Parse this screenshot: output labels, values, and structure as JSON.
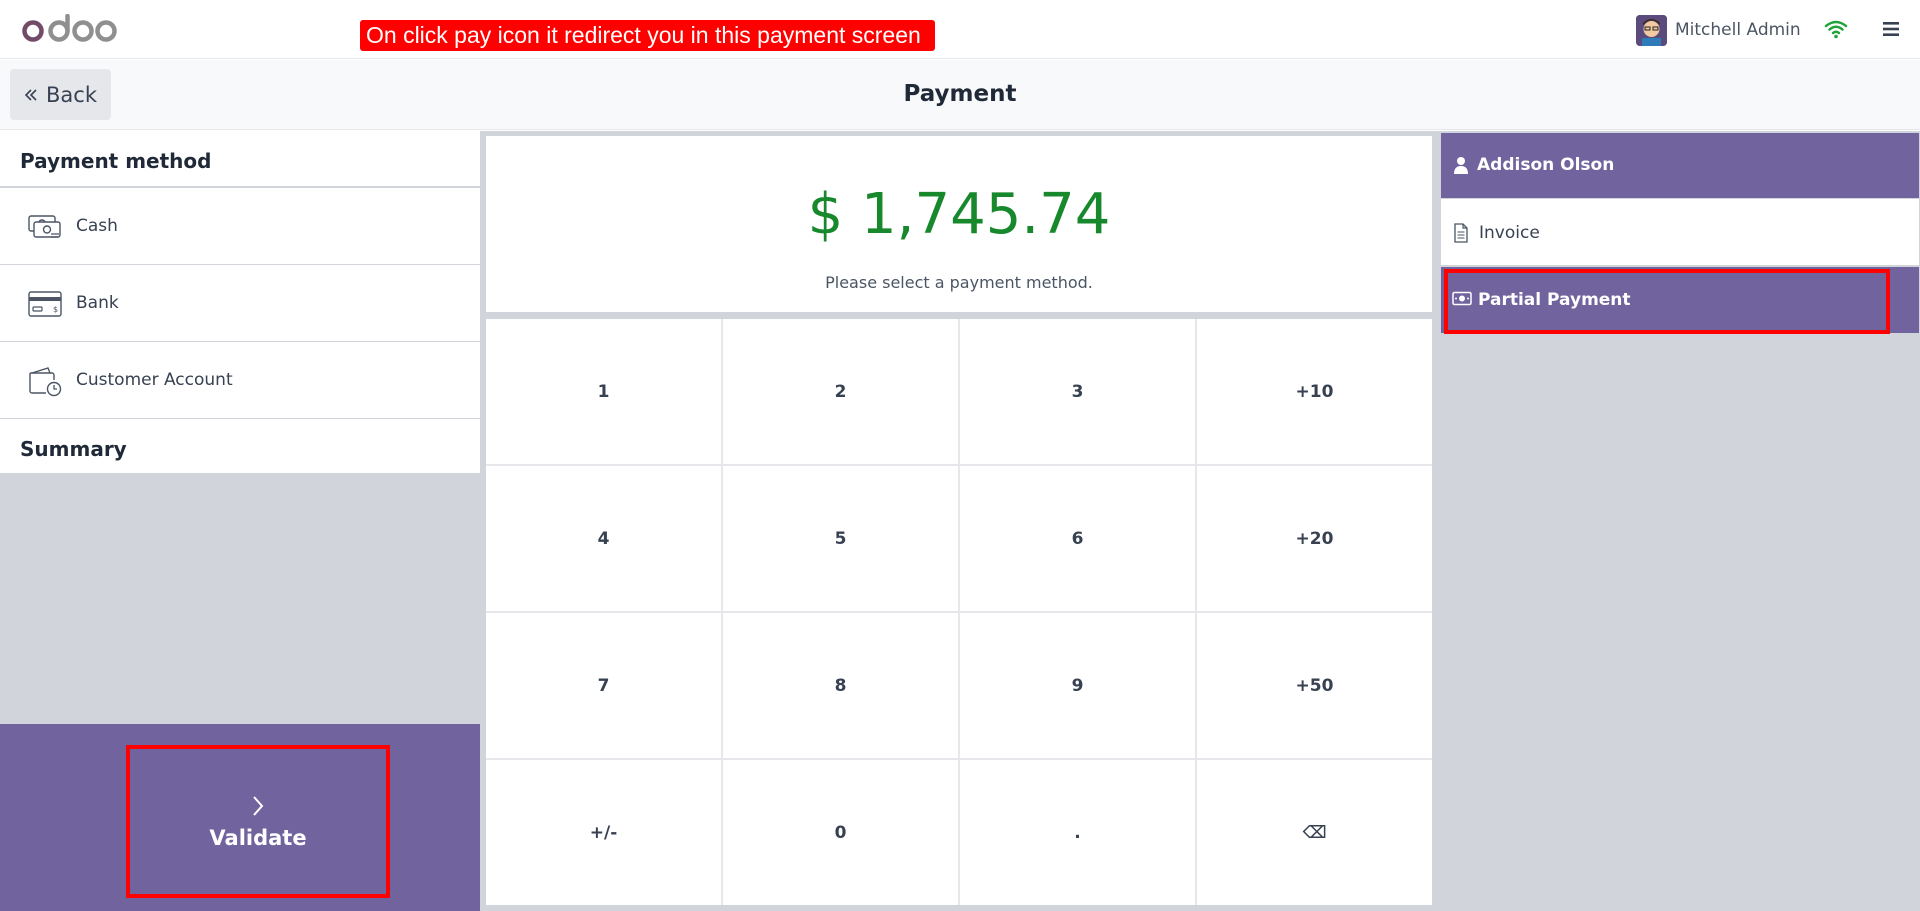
{
  "topbar": {
    "logo_text": "odoo",
    "annotation": "On click pay icon it redirect you in this payment screen",
    "user_name": "Mitchell Admin",
    "icons": [
      "avatar",
      "wifi-icon",
      "hamburger-menu-icon"
    ]
  },
  "subheader": {
    "back_label": "Back",
    "title": "Payment"
  },
  "left": {
    "payment_method_title": "Payment method",
    "methods": [
      {
        "label": "Cash",
        "icon": "cash-icon"
      },
      {
        "label": "Bank",
        "icon": "bank-card-icon"
      },
      {
        "label": "Customer Account",
        "icon": "wallet-clock-icon"
      }
    ],
    "summary_title": "Summary",
    "validate_label": "Validate"
  },
  "center": {
    "amount": "$ 1,745.74",
    "hint": "Please select a payment method.",
    "keys": [
      "1",
      "2",
      "3",
      "+10",
      "4",
      "5",
      "6",
      "+20",
      "7",
      "8",
      "9",
      "+50",
      "+/-",
      "0",
      ".",
      "⌫"
    ]
  },
  "right": {
    "customer_label": "Addison Olson",
    "invoice_label": "Invoice",
    "partial_payment_label": "Partial Payment"
  },
  "colors": {
    "accent": "#71639e",
    "amount": "#17882c",
    "annotation": "#ff0000"
  }
}
